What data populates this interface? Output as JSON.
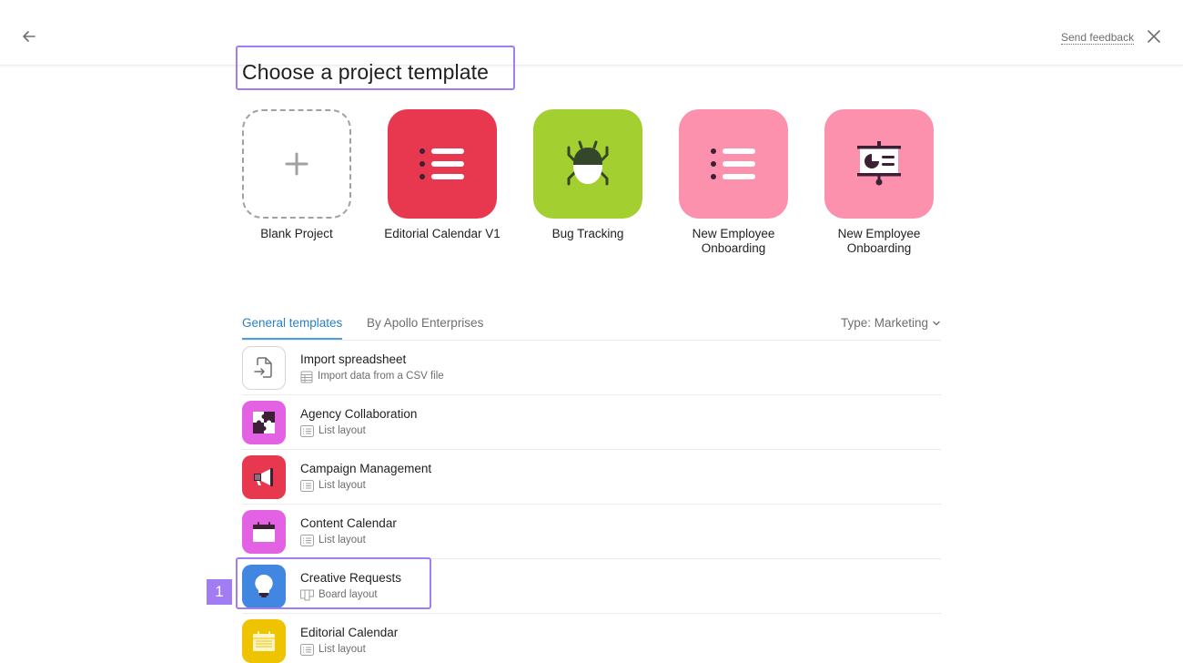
{
  "header": {
    "back_label": "Back",
    "feedback_label": "Send feedback",
    "close_label": "Close"
  },
  "page": {
    "title": "Choose a project template"
  },
  "tiles": [
    {
      "label": "Blank Project",
      "icon": "plus-icon",
      "color": "#ffffff"
    },
    {
      "label": "Editorial Calendar V1",
      "icon": "list-icon",
      "color": "#e8384f"
    },
    {
      "label": "Bug Tracking",
      "icon": "bug-icon",
      "color": "#a4cf30"
    },
    {
      "label": "New Employee Onboarding",
      "icon": "list-icon",
      "color": "#fc91ad"
    },
    {
      "label": "New Employee Onboarding",
      "icon": "presentation-icon",
      "color": "#fc91ad"
    }
  ],
  "tabs": {
    "general": "General templates",
    "org": "By Apollo Enterprises",
    "type_filter": "Type: Marketing"
  },
  "templates": [
    {
      "title": "Import spreadsheet",
      "subtitle": "Import data from a CSV file",
      "icon": "import-file-icon",
      "sub_icon": "spreadsheet-icon",
      "color": "#ffffff"
    },
    {
      "title": "Agency Collaboration",
      "subtitle": "List layout",
      "icon": "puzzle-icon",
      "sub_icon": "list-layout-icon",
      "color": "#e362e3"
    },
    {
      "title": "Campaign Management",
      "subtitle": "List layout",
      "icon": "megaphone-icon",
      "sub_icon": "list-layout-icon",
      "color": "#e8384f"
    },
    {
      "title": "Content Calendar",
      "subtitle": "List layout",
      "icon": "calendar-icon",
      "sub_icon": "list-layout-icon",
      "color": "#e362e3"
    },
    {
      "title": "Creative Requests",
      "subtitle": "Board layout",
      "icon": "lightbulb-icon",
      "sub_icon": "board-layout-icon",
      "color": "#4186e0"
    },
    {
      "title": "Editorial Calendar",
      "subtitle": "List layout",
      "icon": "calendar-icon",
      "sub_icon": "list-layout-icon",
      "color": "#eec300"
    }
  ],
  "annotation": {
    "badge": "1"
  }
}
